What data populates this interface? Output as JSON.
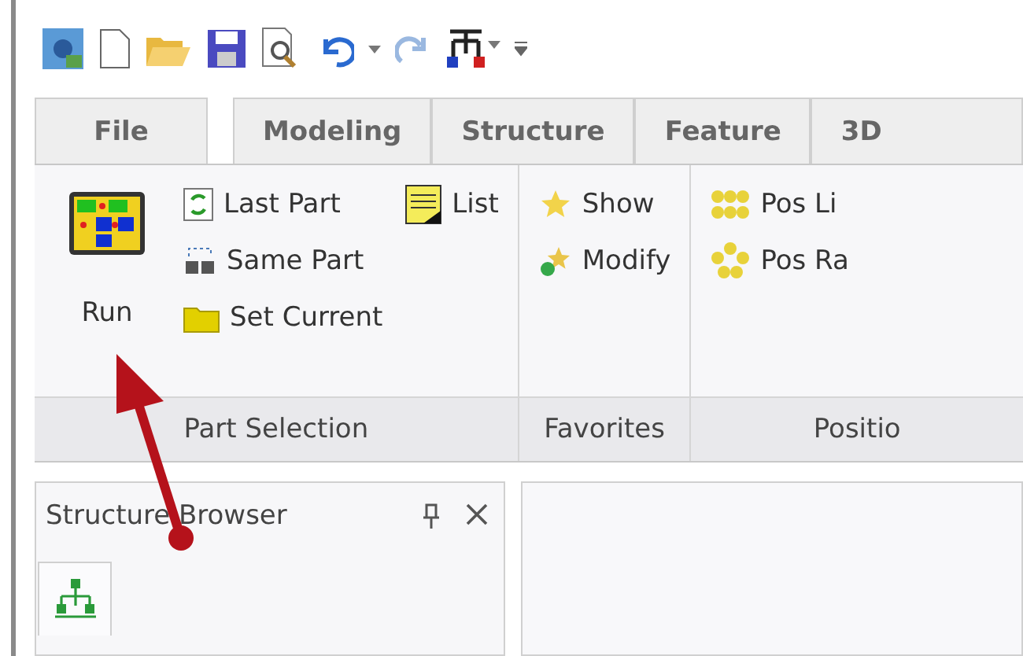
{
  "tabs": [
    {
      "label": "File",
      "kind": "file",
      "selected": false
    },
    {
      "label": "Modeling",
      "kind": "tab",
      "selected": false
    },
    {
      "label": "Structure",
      "kind": "tab",
      "selected": false
    },
    {
      "label": "Feature",
      "kind": "tab",
      "selected": false
    },
    {
      "label": "3D",
      "kind": "tab",
      "selected": false
    }
  ],
  "groups": [
    {
      "label": "Part Selection",
      "kind": "part",
      "large_button": "Run",
      "columns": [
        [
          {
            "label": "Last Part",
            "kind": "refresh"
          },
          {
            "label": "Same Part",
            "kind": "parts"
          },
          {
            "label": "Set Current",
            "kind": "folder"
          }
        ],
        [
          {
            "label": "List",
            "kind": "list"
          }
        ]
      ]
    },
    {
      "label": "Favorites",
      "kind": "small",
      "columns": [
        [
          {
            "label": "Show",
            "kind": "star"
          },
          {
            "label": "Modify",
            "kind": "starplus"
          }
        ]
      ]
    },
    {
      "label": "Positio",
      "kind": "small",
      "columns": [
        [
          {
            "label": "Pos Li",
            "kind": "dots"
          },
          {
            "label": "Pos Ra",
            "kind": "ring"
          }
        ]
      ]
    }
  ],
  "panel": {
    "title": "Structure Browser"
  }
}
